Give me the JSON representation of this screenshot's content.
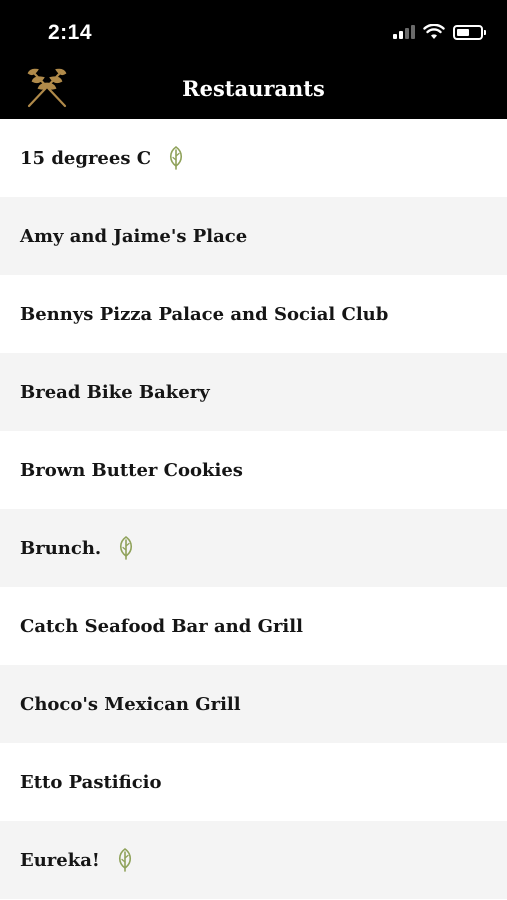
{
  "status_bar": {
    "time": "2:14",
    "battery_level_percent": 55,
    "icons": [
      "cellular-signal-icon",
      "wifi-icon",
      "battery-icon"
    ]
  },
  "header": {
    "title": "Restaurants",
    "logo_icon": "crossed-wheat-logo-icon",
    "logo_color": "#b08a4a"
  },
  "colors": {
    "header_background": "#000000",
    "row_alt_background": "#f4f4f4",
    "leaf_icon": "#8fa25a"
  },
  "restaurants": [
    {
      "name": "15 degrees C",
      "leaf_icon": true
    },
    {
      "name": "Amy and Jaime's Place",
      "leaf_icon": false
    },
    {
      "name": "Bennys Pizza Palace and Social Club",
      "leaf_icon": false
    },
    {
      "name": "Bread Bike Bakery",
      "leaf_icon": false
    },
    {
      "name": "Brown Butter Cookies",
      "leaf_icon": false
    },
    {
      "name": "Brunch.",
      "leaf_icon": true
    },
    {
      "name": "Catch Seafood Bar and Grill",
      "leaf_icon": false
    },
    {
      "name": "Choco's Mexican Grill",
      "leaf_icon": false
    },
    {
      "name": "Etto Pastificio",
      "leaf_icon": false
    },
    {
      "name": "Eureka!",
      "leaf_icon": true
    }
  ]
}
